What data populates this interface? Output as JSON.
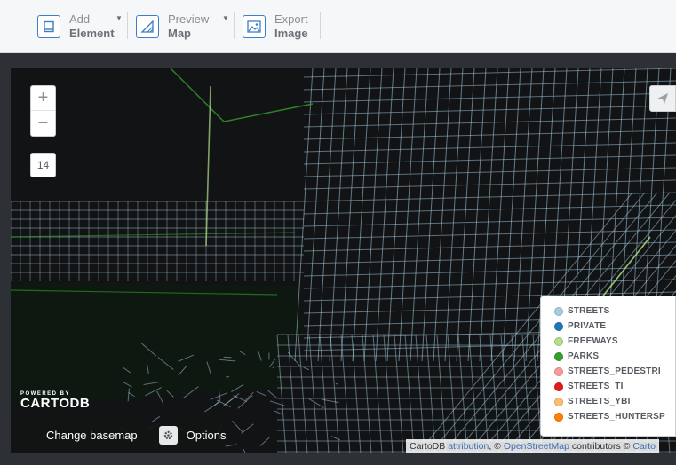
{
  "toolbar": {
    "add": {
      "top": "Add",
      "bottom": "Element",
      "icon": "add-element-icon"
    },
    "preview": {
      "top": "Preview",
      "bottom": "Map",
      "icon": "preview-map-icon"
    },
    "export": {
      "top": "Export",
      "bottom": "Image",
      "icon": "export-image-icon"
    }
  },
  "map": {
    "zoom_in": "+",
    "zoom_out": "−",
    "zoom_level": "14",
    "powered_small": "POWERED BY",
    "powered_big": "CARTODB",
    "change_basemap": "Change basemap",
    "options": "Options",
    "attribution": {
      "prefix": "CartoDB",
      "link1": "attribution",
      "mid": ", © ",
      "link2": "OpenStreetMap",
      "suffix": " contributors © ",
      "link3": "Carto"
    }
  },
  "legend": {
    "items": [
      {
        "label": "STREETS",
        "color": "#a6cee3"
      },
      {
        "label": "PRIVATE",
        "color": "#1f78b4"
      },
      {
        "label": "FREEWAYS",
        "color": "#b2df8a"
      },
      {
        "label": "PARKS",
        "color": "#33a02c"
      },
      {
        "label": "STREETS_PEDESTRI",
        "color": "#fb9a99"
      },
      {
        "label": "STREETS_TI",
        "color": "#e31a1c"
      },
      {
        "label": "STREETS_YBI",
        "color": "#fdbf6f"
      },
      {
        "label": "STREETS_HUNTERSP",
        "color": "#ff7f00"
      }
    ]
  },
  "colors": {
    "accent": "#3f7ec2",
    "map_bg": "#121314",
    "street": "#a6cee3",
    "park": "#33a02c"
  }
}
